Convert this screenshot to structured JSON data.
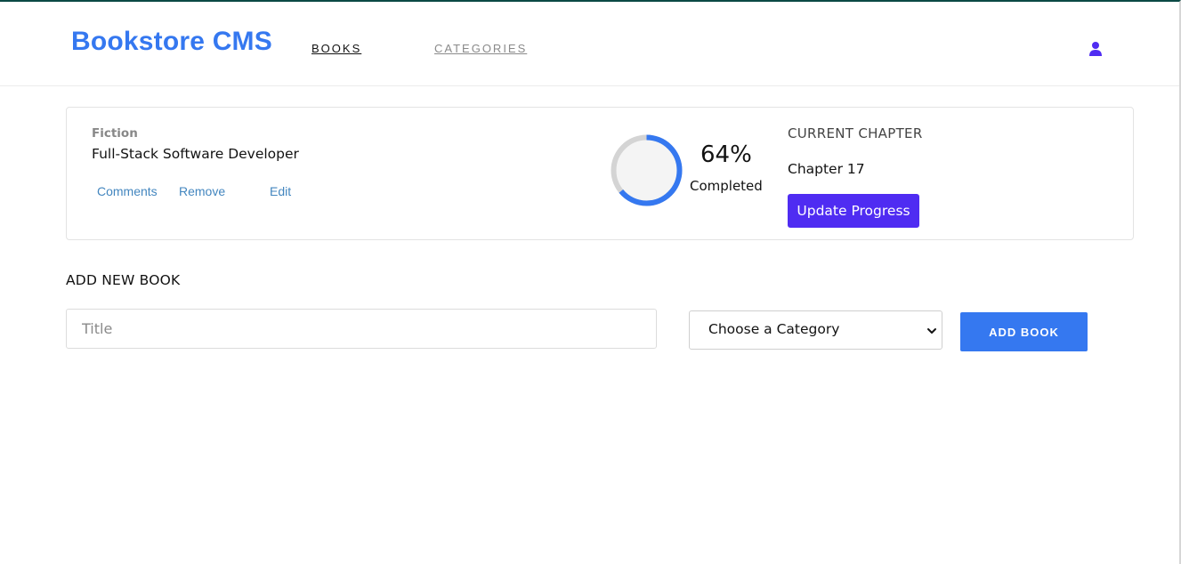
{
  "header": {
    "logo": "Bookstore CMS",
    "nav": {
      "books": "BOOKS",
      "categories": "CATEGORIES"
    },
    "user_icon": "user-icon"
  },
  "book": {
    "genre": "Fiction",
    "title": "Full-Stack Software Developer",
    "actions": {
      "comments": "Comments",
      "remove": "Remove",
      "edit": "Edit"
    },
    "progress": {
      "percent": 64,
      "percent_label": "64%",
      "status": "Completed"
    },
    "chapter": {
      "heading": "CURRENT CHAPTER",
      "value": "Chapter 17",
      "update_label": "Update Progress"
    }
  },
  "add_form": {
    "heading": "ADD NEW BOOK",
    "title_placeholder": "Title",
    "category_selected": "Choose a Category",
    "submit_label": "ADD BOOK"
  },
  "colors": {
    "brand": "#3578f0",
    "update_button": "#4f2cf2",
    "ring_track": "#d4d4d4",
    "ring_fill": "#3578f0",
    "ring_center": "#f4f4f4"
  }
}
